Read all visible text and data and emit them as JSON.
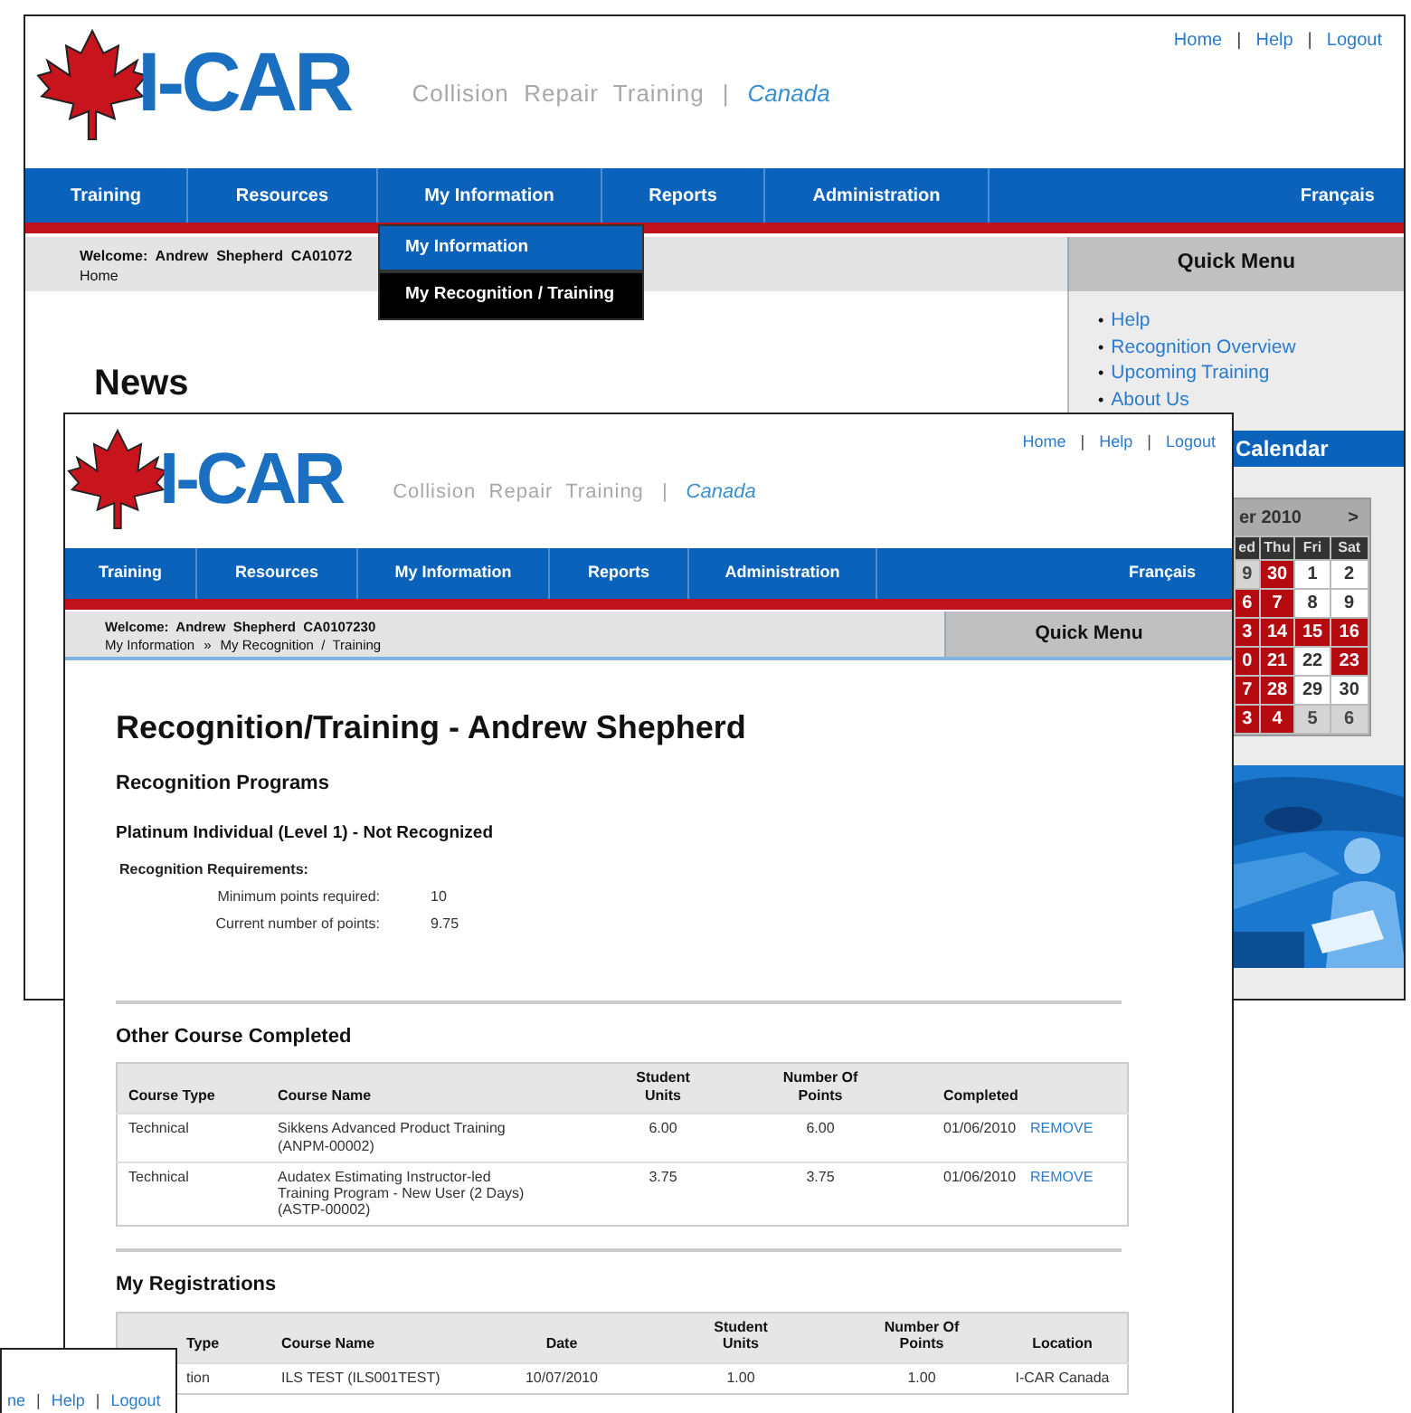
{
  "back_window": {
    "top_links": [
      {
        "kind": "link",
        "text": "Home"
      },
      {
        "kind": "sep",
        "text": "|"
      },
      {
        "kind": "link",
        "text": "Help"
      },
      {
        "kind": "sep",
        "text": "|"
      },
      {
        "kind": "link",
        "text": "Logout"
      }
    ],
    "logo_text": "I-CAR",
    "tagline": "Collision  Repair  Training",
    "tagline_sep": "|",
    "region": "Canada",
    "nav": [
      "Training",
      "Resources",
      "My Information",
      "Reports",
      "Administration"
    ],
    "language": "Français",
    "dropdown": [
      {
        "label": "My Information",
        "selected": false
      },
      {
        "label": "My Recognition / Training",
        "selected": true
      }
    ],
    "welcome": "Welcome:  Andrew  Shepherd  CA01072",
    "breadcrumb": "Home",
    "heading": "News",
    "quick_menu": {
      "title": "Quick Menu",
      "links": [
        {
          "bullet": "•",
          "text": "Help"
        },
        {
          "bullet": "•",
          "text": "Recognition Overview"
        },
        {
          "bullet": "•",
          "text": "Upcoming Training"
        },
        {
          "bullet": "•",
          "text": "About Us"
        }
      ]
    },
    "calendar": {
      "title": "Calendar",
      "month": "er 2010",
      "next": ">",
      "weekdays": [
        "ed",
        "Thu",
        "Fri",
        "Sat"
      ],
      "weeks": [
        [
          {
            "day": "9",
            "kind": "other"
          },
          {
            "day": "30",
            "kind": "event"
          },
          {
            "day": "1",
            "kind": "plain"
          },
          {
            "day": "2",
            "kind": "plain"
          }
        ],
        [
          {
            "day": "6",
            "kind": "event"
          },
          {
            "day": "7",
            "kind": "event"
          },
          {
            "day": "8",
            "kind": "plain"
          },
          {
            "day": "9",
            "kind": "plain"
          }
        ],
        [
          {
            "day": "3",
            "kind": "event"
          },
          {
            "day": "14",
            "kind": "event"
          },
          {
            "day": "15",
            "kind": "event"
          },
          {
            "day": "16",
            "kind": "event"
          }
        ],
        [
          {
            "day": "0",
            "kind": "event"
          },
          {
            "day": "21",
            "kind": "event"
          },
          {
            "day": "22",
            "kind": "plain"
          },
          {
            "day": "23",
            "kind": "event"
          }
        ],
        [
          {
            "day": "7",
            "kind": "event"
          },
          {
            "day": "28",
            "kind": "event"
          },
          {
            "day": "29",
            "kind": "plain"
          },
          {
            "day": "30",
            "kind": "plain"
          }
        ],
        [
          {
            "day": "3",
            "kind": "event"
          },
          {
            "day": "4",
            "kind": "event"
          },
          {
            "day": "5",
            "kind": "other"
          },
          {
            "day": "6",
            "kind": "other"
          }
        ]
      ]
    },
    "photo": {
      "kind": "picture"
    }
  },
  "front_window": {
    "top_links": [
      {
        "kind": "link",
        "text": "Home"
      },
      {
        "kind": "sep",
        "text": "|"
      },
      {
        "kind": "link",
        "text": "Help"
      },
      {
        "kind": "sep",
        "text": "|"
      },
      {
        "kind": "link",
        "text": "Logout"
      }
    ],
    "logo_text": "I-CAR",
    "tagline": "Collision  Repair  Training",
    "tagline_sep": "|",
    "region": "Canada",
    "nav": [
      "Training",
      "Resources",
      "My Information",
      "Reports",
      "Administration"
    ],
    "language": "Français",
    "welcome": "Welcome:  Andrew  Shepherd  CA0107230",
    "breadcrumb": [
      {
        "kind": "crumb",
        "text": "My Information"
      },
      {
        "kind": "sep",
        "text": "»"
      },
      {
        "kind": "crumb",
        "text": "My Recognition  /  Training"
      }
    ],
    "quick_menu_title": "Quick Menu",
    "title": "Recognition/Training - Andrew Shepherd",
    "programs_heading": "Recognition Programs",
    "program": "Platinum Individual (Level 1) - Not Recognized",
    "requirements": {
      "title": "Recognition Requirements:",
      "rows": [
        {
          "label": "Minimum points required:",
          "value": "10"
        },
        {
          "label": "Current number of points:",
          "value": "9.75"
        }
      ]
    },
    "completed": {
      "title": "Other Course Completed",
      "columns": [
        [
          "Course Type"
        ],
        [
          "Course Name"
        ],
        [
          "Student",
          "Units"
        ],
        [
          "Number Of",
          "Points"
        ],
        [
          "Completed"
        ]
      ],
      "rows": [
        {
          "type": "Technical",
          "name": [
            "Sikkens Advanced Product Training",
            "(ANPM-00002)"
          ],
          "units": "6.00",
          "points": "6.00",
          "completed": "01/06/2010",
          "action": "REMOVE"
        },
        {
          "type": "Technical",
          "name": [
            "Audatex Estimating Instructor-led",
            "Training Program - New User (2 Days)",
            "(ASTP-00002)"
          ],
          "units": "3.75",
          "points": "3.75",
          "completed": "01/06/2010",
          "action": "REMOVE"
        }
      ]
    },
    "registrations": {
      "title": "My Registrations",
      "columns": [
        [
          "Type"
        ],
        [
          "Course Name"
        ],
        [
          "Date"
        ],
        [
          "Student",
          "Units"
        ],
        [
          "Number Of",
          "Points"
        ],
        [
          "Location"
        ]
      ],
      "rows": [
        {
          "type": "tion",
          "name": "ILS TEST (ILS001TEST)",
          "date": "10/07/2010",
          "units": "1.00",
          "points": "1.00",
          "location": "I-CAR Canada"
        }
      ]
    }
  },
  "corner_window": {
    "top_links": [
      {
        "kind": "link",
        "text": "ne"
      },
      {
        "kind": "sep",
        "text": "|"
      },
      {
        "kind": "link",
        "text": "Help"
      },
      {
        "kind": "sep",
        "text": "|"
      },
      {
        "kind": "link",
        "text": "Logout"
      }
    ]
  }
}
